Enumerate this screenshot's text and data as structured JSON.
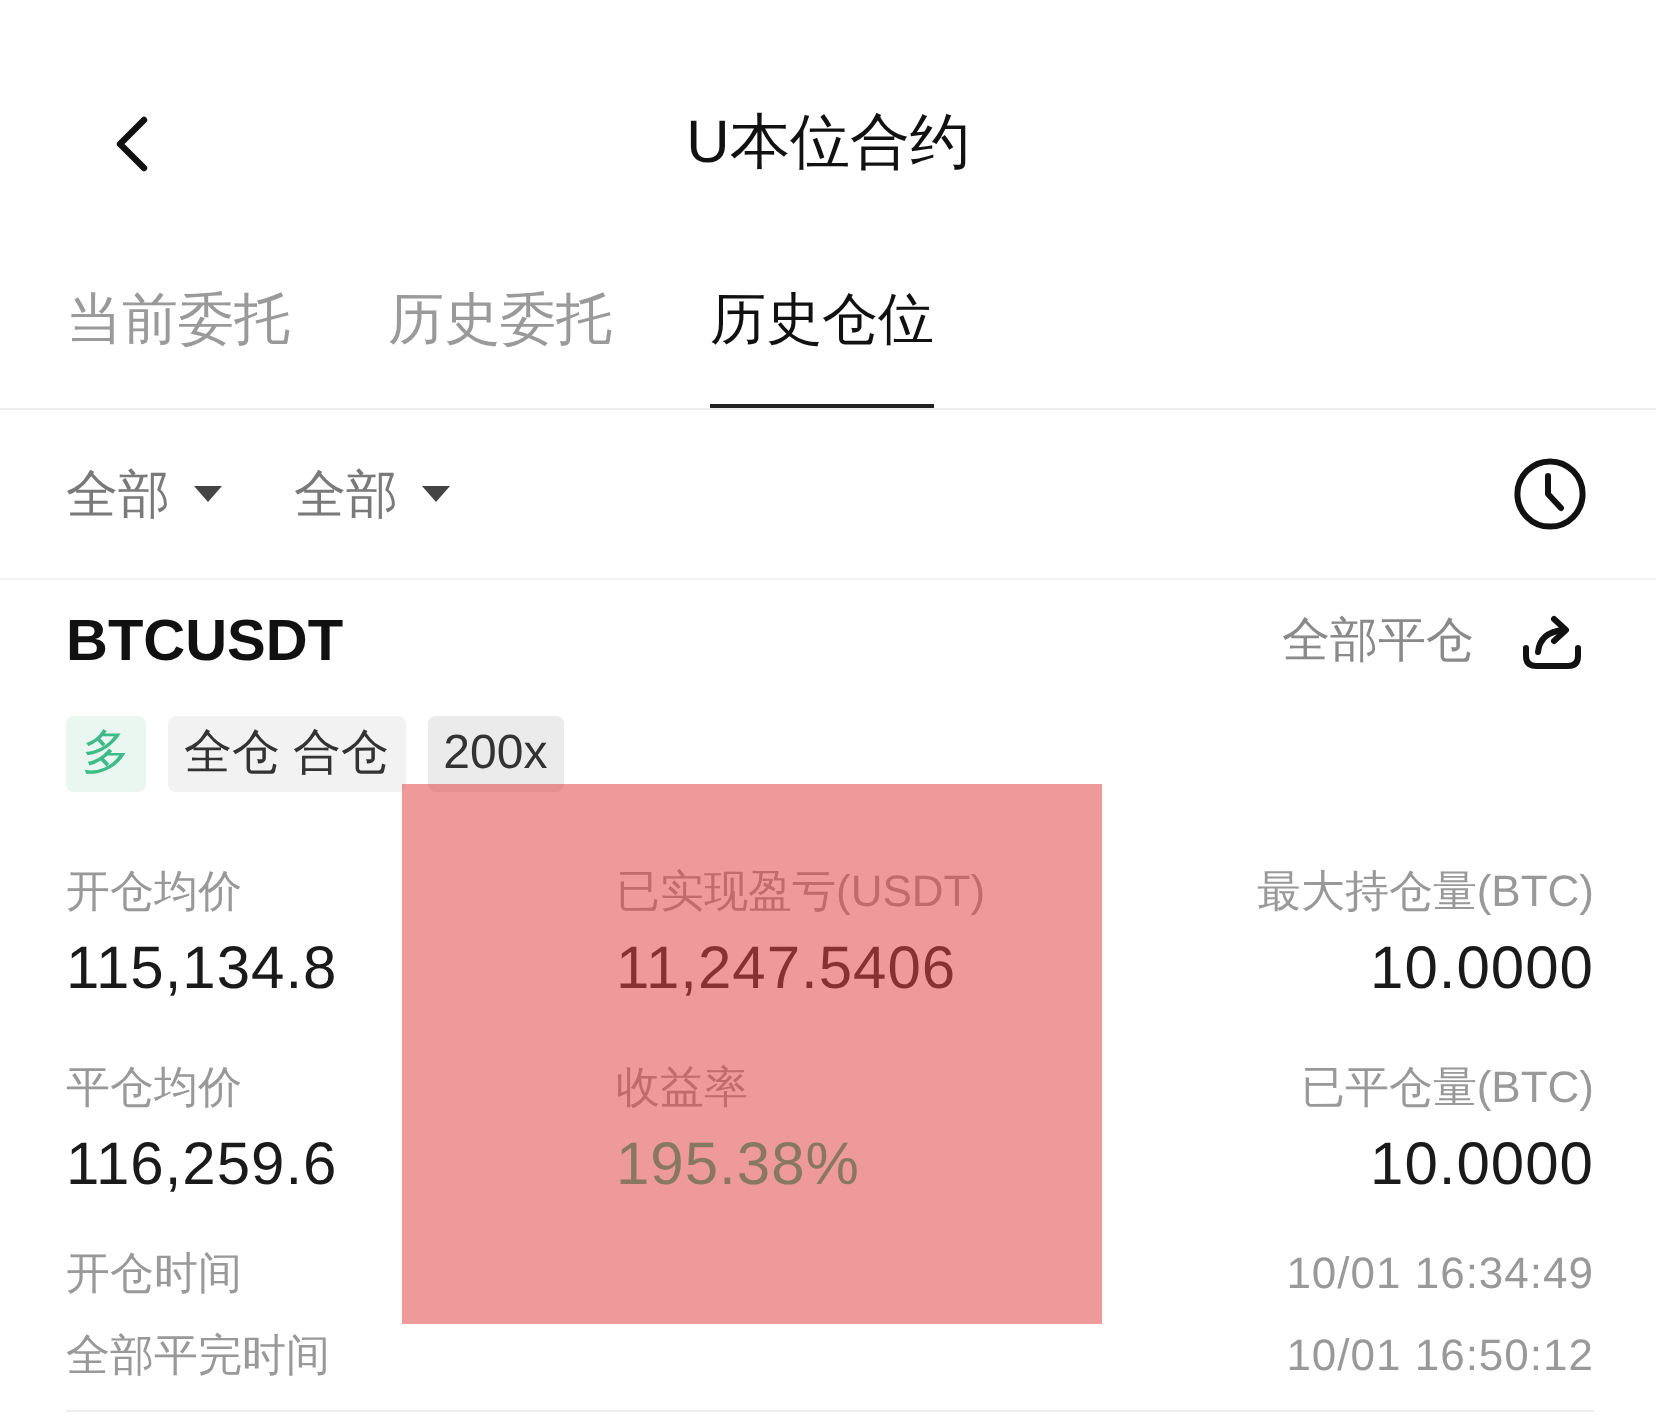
{
  "header": {
    "title": "U本位合约"
  },
  "tabs": [
    {
      "label": "当前委托",
      "selected": false
    },
    {
      "label": "历史委托",
      "selected": false
    },
    {
      "label": "历史仓位",
      "selected": true
    }
  ],
  "filters": [
    {
      "label": "全部"
    },
    {
      "label": "全部"
    }
  ],
  "position": {
    "symbol": "BTCUSDT",
    "close_all": "全部平仓",
    "tags": [
      {
        "label": "多",
        "kind": "side"
      },
      {
        "label": "全仓 合仓",
        "kind": "mode"
      },
      {
        "label": "200x",
        "kind": "leverage"
      }
    ],
    "stats": [
      {
        "label": "开仓均价",
        "value": "115,134.8",
        "kind": "plain"
      },
      {
        "label": "已实现盈亏(USDT)",
        "value": "11,247.5406",
        "kind": "plain"
      },
      {
        "label": "最大持仓量(BTC)",
        "value": "10.0000",
        "kind": "plain"
      },
      {
        "label": "平仓均价",
        "value": "116,259.6",
        "kind": "plain"
      },
      {
        "label": "收益率",
        "value": "195.38%",
        "kind": "profit"
      },
      {
        "label": "已平仓量(BTC)",
        "value": "10.0000",
        "kind": "plain"
      }
    ],
    "times": [
      {
        "label": "开仓时间",
        "value": "10/01 16:34:49"
      },
      {
        "label": "全部平完时间",
        "value": "10/01 16:50:12"
      }
    ]
  }
}
